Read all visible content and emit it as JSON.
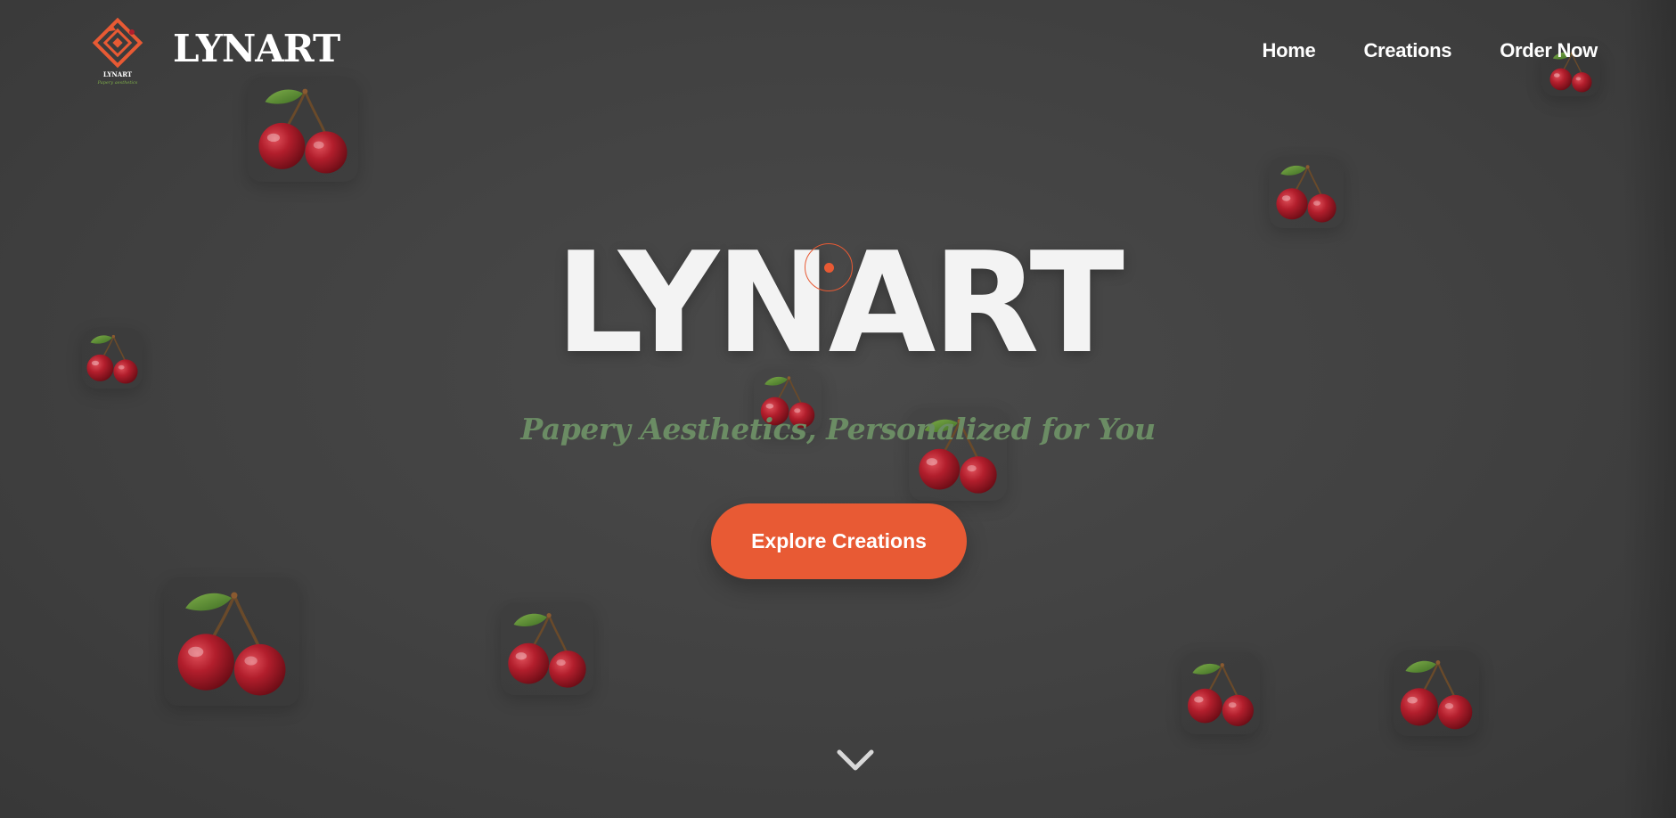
{
  "brand": {
    "name": "LYNART",
    "logo_text": "LYNART",
    "logo_subtext": "Papery aesthetics"
  },
  "nav": {
    "items": [
      {
        "label": "Home"
      },
      {
        "label": "Creations"
      },
      {
        "label": "Order Now"
      }
    ]
  },
  "hero": {
    "title": "LYNART",
    "tagline": "Papery Aesthetics, Personalized for You",
    "cta_label": "Explore Creations",
    "scroll_icon": "chevron-down-icon"
  },
  "decorations": {
    "cherry_icon": "cherry-icon"
  },
  "colors": {
    "background": "#434343",
    "accent": "#e85a34",
    "tagline": "#6b8c64",
    "text": "#f3f3f3"
  }
}
